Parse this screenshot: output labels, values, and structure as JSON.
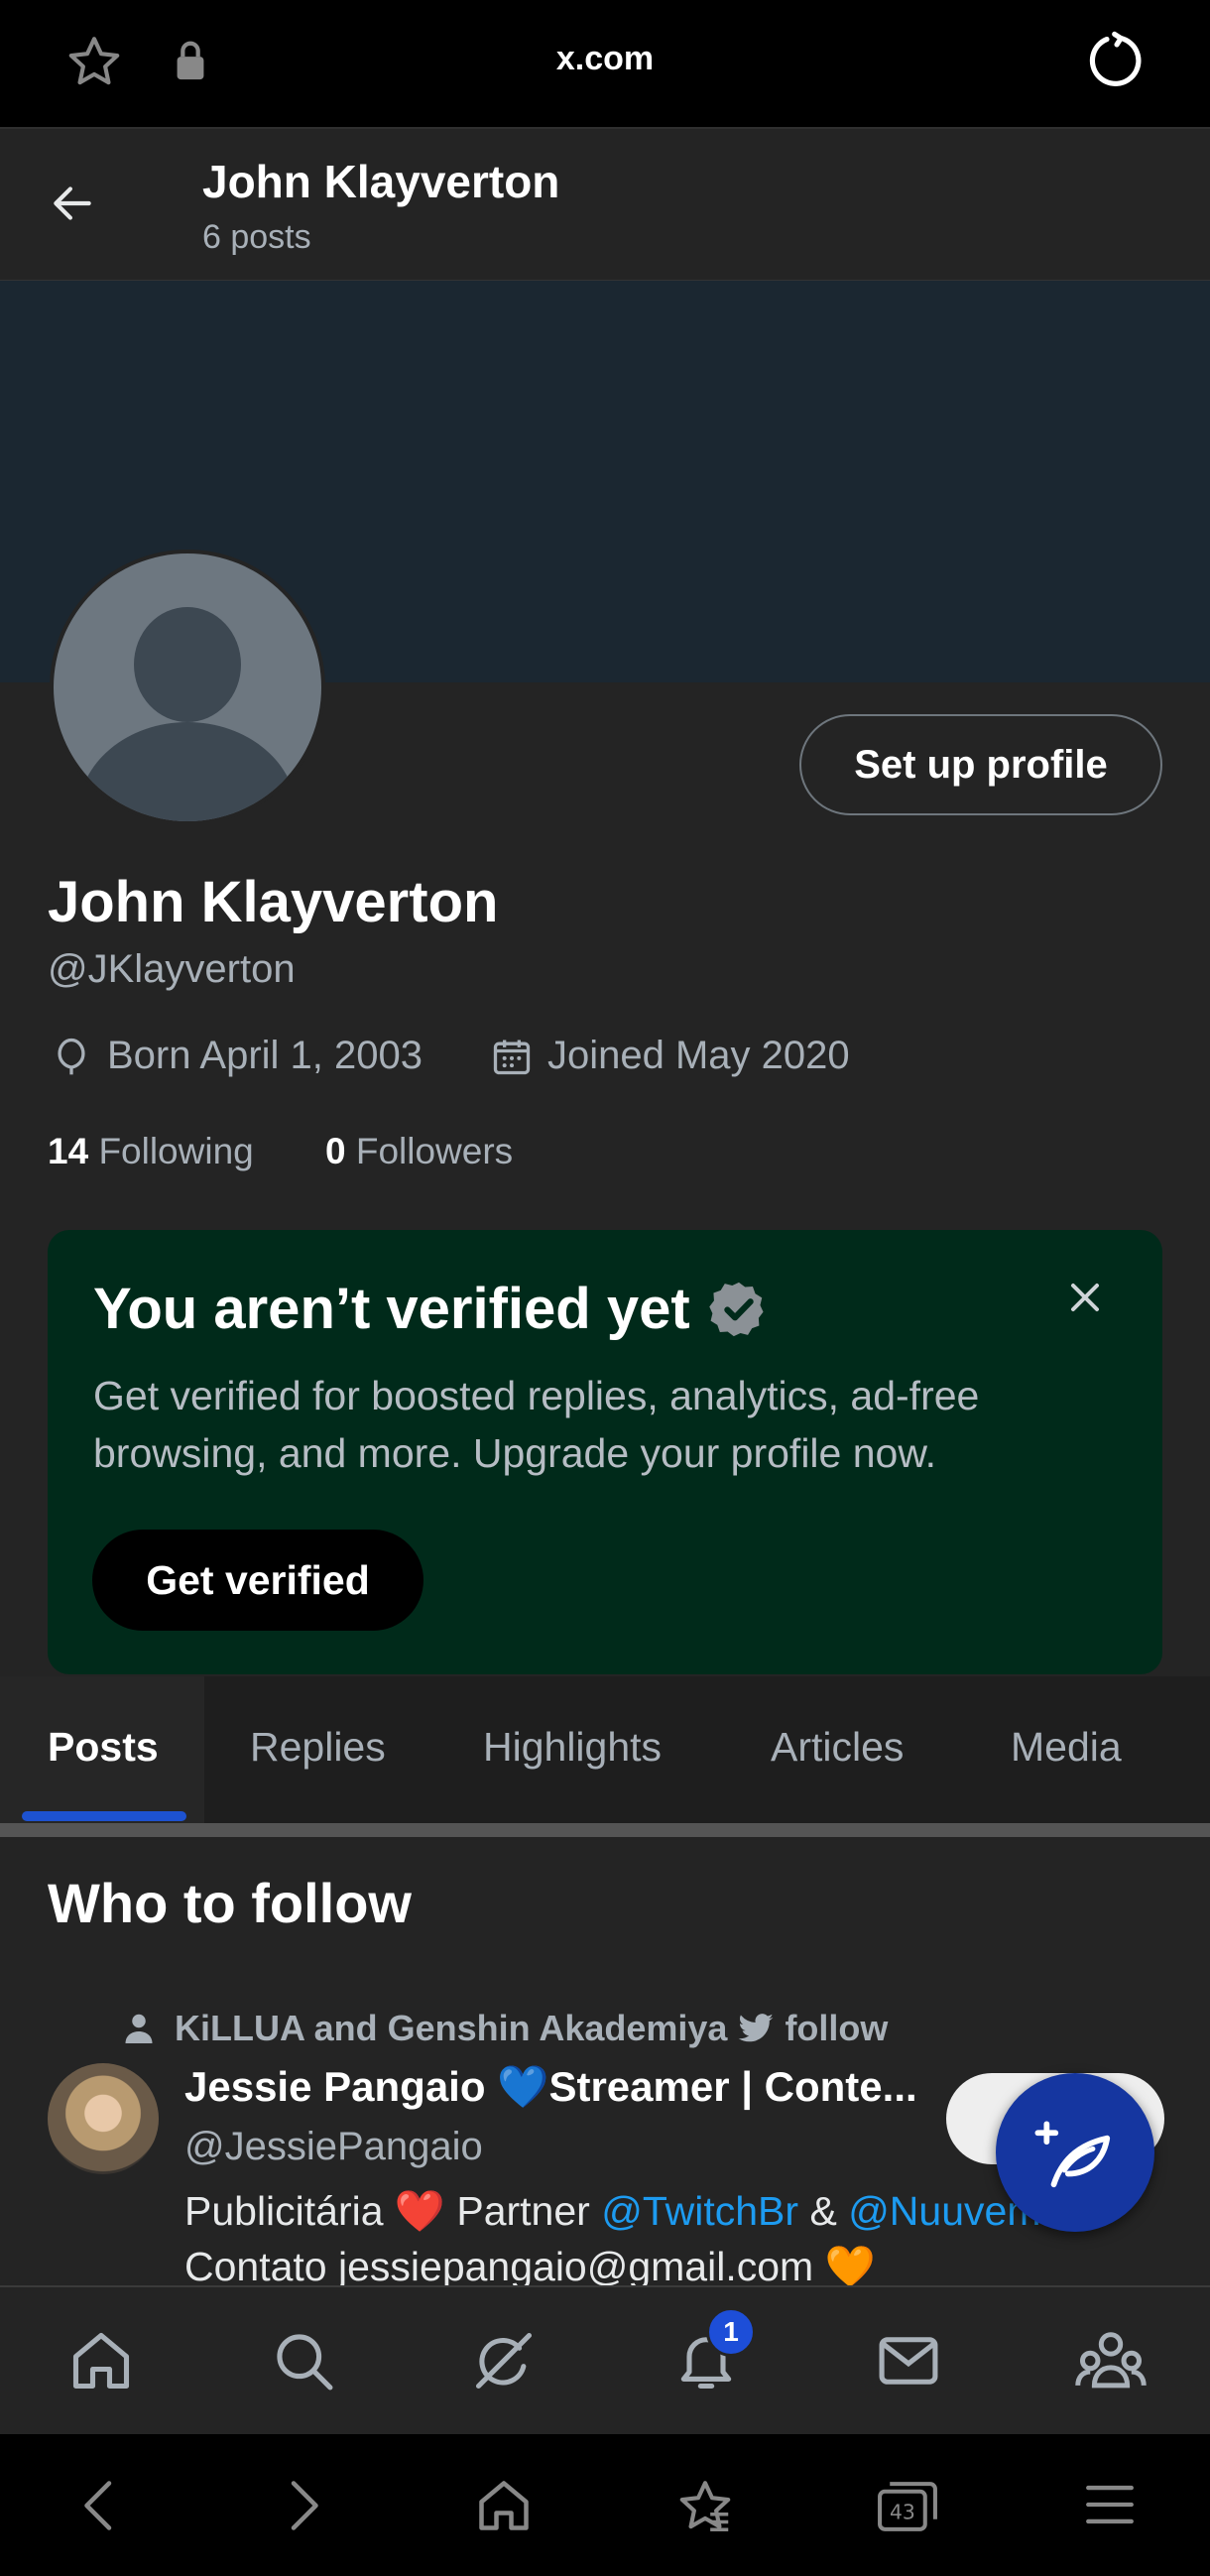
{
  "browser": {
    "url": "x.com",
    "tabs_count": "43"
  },
  "header": {
    "title": "John Klayverton",
    "subtitle": "6 posts"
  },
  "profile": {
    "setup_button": "Set up profile",
    "name": "John Klayverton",
    "handle": "@JKlayverton",
    "born": "Born April 1, 2003",
    "joined": "Joined May 2020",
    "following_count": "14",
    "following_label": "Following",
    "followers_count": "0",
    "followers_label": "Followers"
  },
  "verify_card": {
    "title": "You aren’t verified yet",
    "body": "Get verified for boosted replies, analytics, ad-free browsing, and more. Upgrade your profile now.",
    "button": "Get verified"
  },
  "tabs": [
    {
      "label": "Posts",
      "active": true
    },
    {
      "label": "Replies",
      "active": false
    },
    {
      "label": "Highlights",
      "active": false
    },
    {
      "label": "Articles",
      "active": false
    },
    {
      "label": "Media",
      "active": false
    }
  ],
  "who_to_follow": {
    "title": "Who to follow",
    "context": "KiLLUA and Genshin Akademiya",
    "context_suffix": "follow",
    "user": {
      "name": "Jessie Pangaio 💙Streamer | Conte...",
      "handle": "@JessiePangaio",
      "bio_prefix": "Publicitária ❤️ Partner ",
      "bio_link1": "@TwitchBr",
      "bio_mid": " & ",
      "bio_link2": "@Nuuvem",
      "bio_line2": "Contato jessiepangaio@gmail.com 🧡"
    }
  },
  "notifications": {
    "badge": "1"
  },
  "colors": {
    "accent": "#1d9bf0",
    "verify_card_bg": "#002a1a",
    "fab": "#1536a0",
    "tab_indicator": "#1d52d0"
  }
}
